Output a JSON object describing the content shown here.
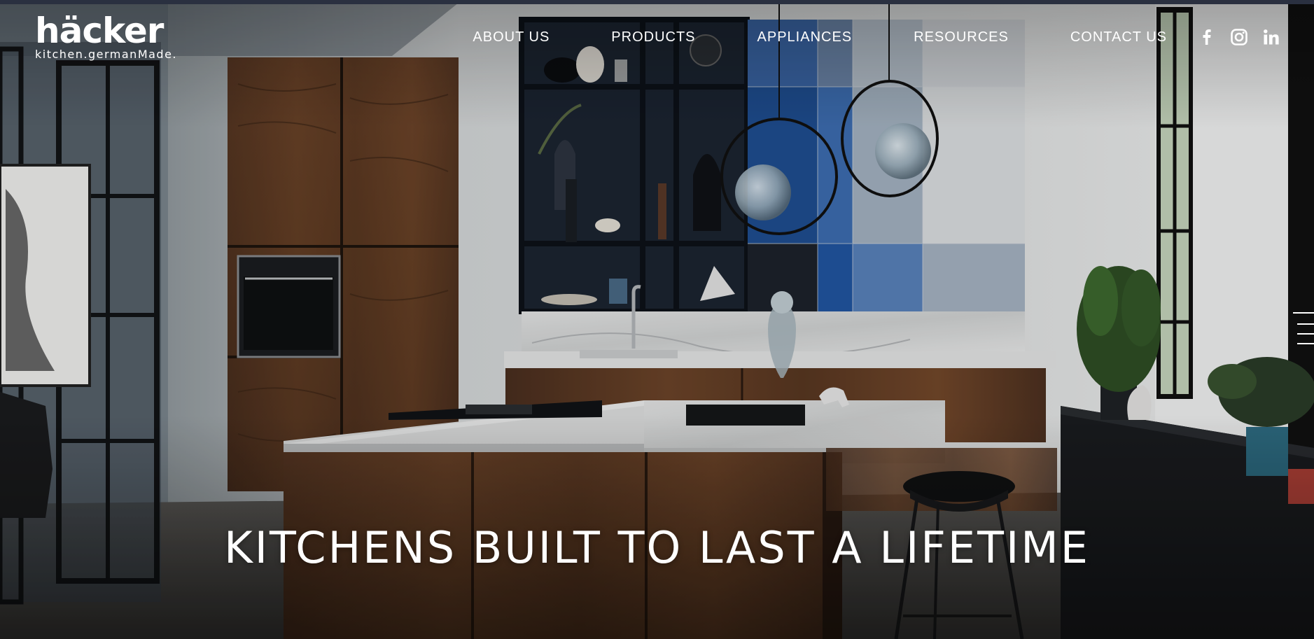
{
  "brand": {
    "name": "häcker",
    "tagline": "kitchen.germanMade."
  },
  "nav": {
    "items": [
      "ABOUT US",
      "PRODUCTS",
      "APPLIANCES",
      "RESOURCES",
      "CONTACT US"
    ]
  },
  "social": {
    "icons": [
      "facebook-icon",
      "instagram-icon",
      "linkedin-icon"
    ]
  },
  "hero": {
    "headline": "KITCHENS BUILT TO LAST A LIFETIME"
  },
  "colors": {
    "nav_text": "#ffffff",
    "walnut": "#5a3a26",
    "blue_tile": "#2e5fa8",
    "marble": "#dfe0e0",
    "dark_shelf": "#1b2430"
  }
}
